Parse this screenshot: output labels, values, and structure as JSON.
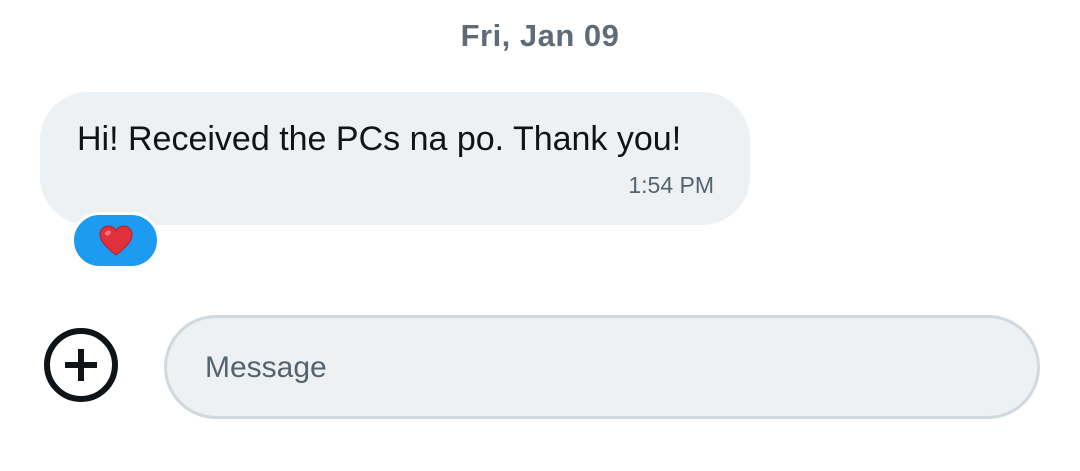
{
  "conversation": {
    "date_divider": "Fri, Jan 09",
    "messages": [
      {
        "text": "Hi! Received the PCs na po. Thank you!",
        "time": "1:54 PM",
        "reaction": {
          "icon": "heart-emoji",
          "emoji": "❤️",
          "background_color": "#1d9bf0"
        }
      }
    ]
  },
  "composer": {
    "add_icon": "plus-circle-icon",
    "placeholder": "Message",
    "value": ""
  },
  "colors": {
    "bubble_background": "#eef1f3",
    "reaction_accent": "#1d9bf0",
    "text_primary": "#0f1419",
    "text_secondary": "#536471"
  }
}
